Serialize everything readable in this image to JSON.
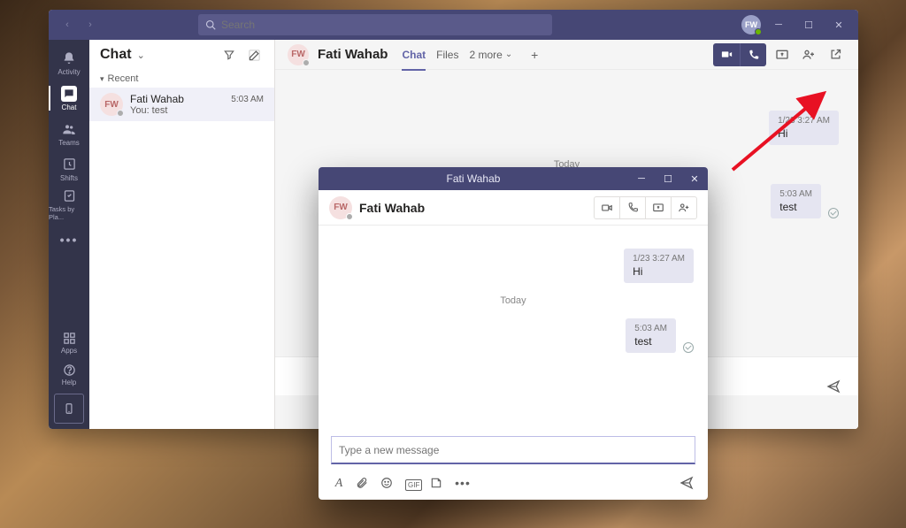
{
  "titlebar": {
    "search_placeholder": "Search",
    "avatar_initials": "FW"
  },
  "rail": {
    "activity": "Activity",
    "chat": "Chat",
    "teams": "Teams",
    "shifts": "Shifts",
    "tasks": "Tasks by Pla...",
    "apps": "Apps",
    "help": "Help"
  },
  "chatlist": {
    "title": "Chat",
    "section_recent": "Recent",
    "items": [
      {
        "initials": "FW",
        "name": "Fati Wahab",
        "preview": "You: test",
        "time": "5:03 AM"
      }
    ]
  },
  "conversation": {
    "initials": "FW",
    "name": "Fati Wahab",
    "tabs": {
      "chat": "Chat",
      "files": "Files",
      "more": "2 more"
    },
    "messages": [
      {
        "timestamp": "1/23 3:27 AM",
        "text": "Hi"
      },
      {
        "timestamp": "5:03 AM",
        "text": "test"
      }
    ],
    "day_label": "Today"
  },
  "popout": {
    "window_title": "Fati Wahab",
    "initials": "FW",
    "name": "Fati Wahab",
    "day_label": "Today",
    "messages": [
      {
        "timestamp": "1/23 3:27 AM",
        "text": "Hi"
      },
      {
        "timestamp": "5:03 AM",
        "text": "test"
      }
    ],
    "compose_placeholder": "Type a new message"
  }
}
